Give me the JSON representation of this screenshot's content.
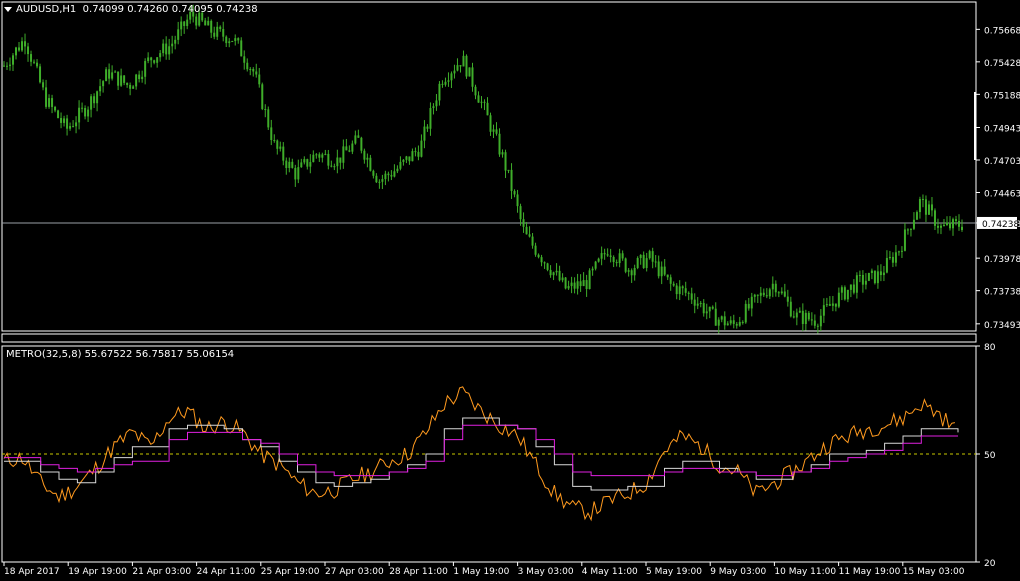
{
  "main_header": {
    "symbol": "AUDUSD,H1",
    "ohlc": "0.74099 0.74260 0.74095 0.74238"
  },
  "indicator_header": {
    "label": "METRO(32,5,8) 55.67522 56.75817 55.06154"
  },
  "colors": {
    "background": "#000000",
    "frame": "#ffffff",
    "candles": "#3fae2a",
    "bid_line": "#9aa0a6",
    "metro_fast": "#ff9a1f",
    "metro_step_fast": "#d9d9d9",
    "metro_step_slow": "#e020e0",
    "level_line": "#c8c800"
  },
  "chart_data": [
    {
      "type": "candlestick",
      "title": "AUDUSD,H1",
      "y_ticks": [
        "0.75668",
        "0.75428",
        "0.75188",
        "0.74943",
        "0.74703",
        "0.74463",
        "0.74238",
        "0.73978",
        "0.73738",
        "0.73493"
      ],
      "ylim": [
        0.7344,
        0.7587
      ],
      "current_price": 0.74238,
      "current_price_label": "0.74238",
      "close_path": [
        0.754,
        0.756,
        0.7515,
        0.7493,
        0.751,
        0.7535,
        0.7525,
        0.7545,
        0.7555,
        0.7578,
        0.7565,
        0.756,
        0.7535,
        0.748,
        0.746,
        0.7475,
        0.747,
        0.7485,
        0.7455,
        0.7465,
        0.748,
        0.753,
        0.7545,
        0.751,
        0.747,
        0.7415,
        0.7395,
        0.7375,
        0.738,
        0.7405,
        0.739,
        0.7398,
        0.7378,
        0.737,
        0.7355,
        0.7348,
        0.7365,
        0.738,
        0.7355,
        0.7352,
        0.7368,
        0.738,
        0.7385,
        0.7405,
        0.744,
        0.742,
        0.7423
      ],
      "series": [
        {
          "name": "AUDUSD,H1"
        }
      ]
    },
    {
      "type": "line",
      "title": "METRO(32,5,8)",
      "y_ticks": [
        "80",
        "50",
        "20"
      ],
      "ylim": [
        20,
        80
      ],
      "level": 50,
      "values_label": "55.67522 56.75817 55.06154",
      "x_ticks": [
        "18 Apr 2017",
        "19 Apr 19:00",
        "21 Apr 03:00",
        "24 Apr 11:00",
        "25 Apr 19:00",
        "27 Apr 03:00",
        "28 Apr 11:00",
        "1 May 19:00",
        "3 May 03:00",
        "4 May 11:00",
        "5 May 19:00",
        "9 May 03:00",
        "10 May 11:00",
        "11 May 19:00",
        "15 May 03:00"
      ],
      "series": [
        {
          "values": [
            48,
            49,
            42,
            38,
            41,
            46,
            52,
            56,
            52,
            60,
            62,
            57,
            59,
            56,
            50,
            47,
            42,
            39,
            40,
            43,
            45,
            48,
            50,
            56,
            64,
            67,
            62,
            58,
            55,
            47,
            39,
            35,
            34,
            37,
            39,
            42,
            51,
            55,
            52,
            47,
            45,
            39,
            42,
            45,
            49,
            53,
            55,
            57,
            58,
            60,
            64,
            61,
            56
          ]
        },
        {
          "values": [
            48,
            48,
            45,
            43,
            42,
            45,
            49,
            52,
            52,
            57,
            58,
            58,
            57,
            54,
            52,
            48,
            45,
            42,
            41,
            42,
            43,
            45,
            47,
            50,
            57,
            60,
            60,
            58,
            57,
            52,
            47,
            41,
            40,
            40,
            41,
            41,
            46,
            48,
            48,
            46,
            45,
            43,
            43,
            45,
            47,
            50,
            50,
            51,
            53,
            55,
            57,
            57,
            56
          ]
        },
        {
          "values": [
            49,
            49,
            47,
            46,
            45,
            46,
            47,
            48,
            48,
            54,
            56,
            56,
            56,
            54,
            53,
            50,
            47,
            45,
            44,
            44,
            44,
            45,
            46,
            48,
            54,
            58,
            58,
            58,
            57,
            54,
            50,
            45,
            44,
            44,
            44,
            44,
            45,
            46,
            46,
            45,
            45,
            44,
            44,
            45,
            46,
            48,
            49,
            50,
            51,
            53,
            55,
            55,
            55
          ]
        }
      ]
    }
  ]
}
